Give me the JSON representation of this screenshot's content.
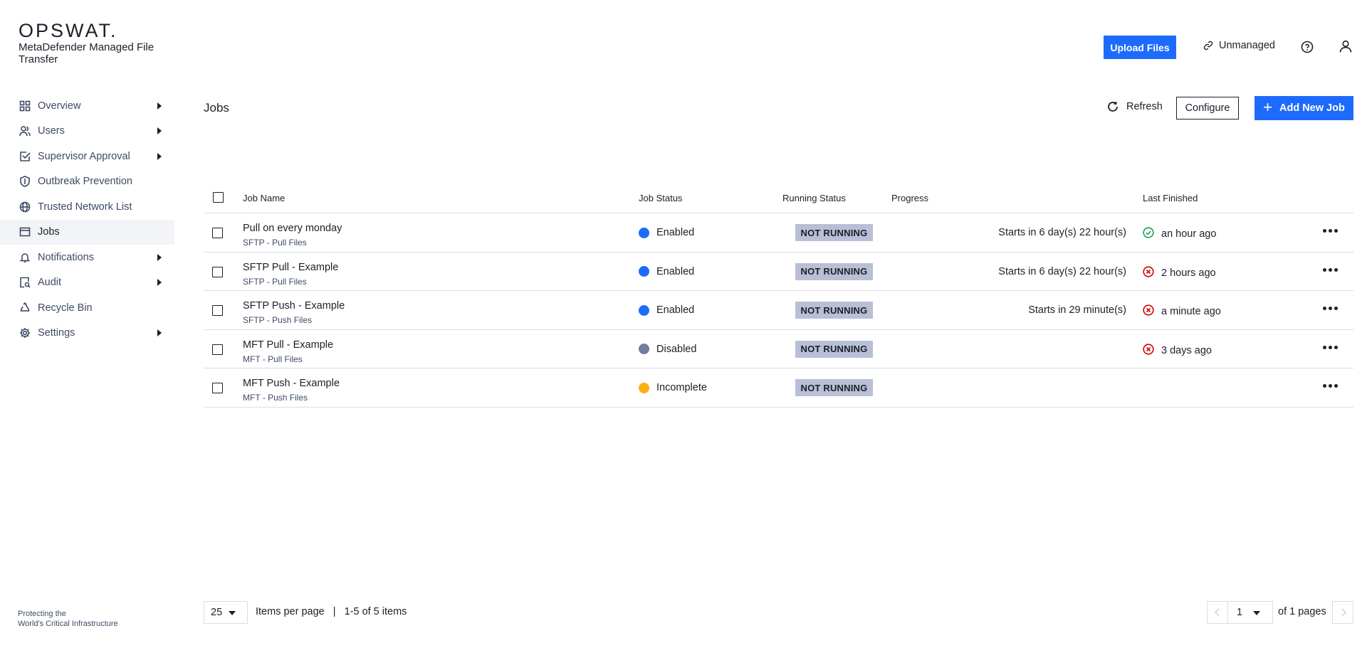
{
  "brand": {
    "logo": "OPSWAT.",
    "product": "MetaDefender Managed File Transfer",
    "tagline_line1": "Protecting the",
    "tagline_line2": "World's Critical Infrastructure"
  },
  "header": {
    "upload_label": "Upload Files",
    "unmanaged_label": "Unmanaged",
    "help_icon": "help-circle-icon",
    "user_icon": "user-icon"
  },
  "sidebar": {
    "items": [
      {
        "label": "Overview",
        "icon": "grid-icon",
        "expandable": true
      },
      {
        "label": "Users",
        "icon": "users-icon",
        "expandable": true
      },
      {
        "label": "Supervisor Approval",
        "icon": "checkbox-icon",
        "expandable": true
      },
      {
        "label": "Outbreak Prevention",
        "icon": "shield-icon",
        "expandable": false
      },
      {
        "label": "Trusted Network List",
        "icon": "globe-icon",
        "expandable": false
      },
      {
        "label": "Jobs",
        "icon": "window-icon",
        "expandable": false,
        "active": true
      },
      {
        "label": "Notifications",
        "icon": "bell-icon",
        "expandable": true
      },
      {
        "label": "Audit",
        "icon": "audit-icon",
        "expandable": true
      },
      {
        "label": "Recycle Bin",
        "icon": "recycle-icon",
        "expandable": false
      },
      {
        "label": "Settings",
        "icon": "gear-icon",
        "expandable": true
      }
    ]
  },
  "page": {
    "title": "Jobs",
    "refresh_label": "Refresh",
    "configure_label": "Configure",
    "add_label": "Add New Job"
  },
  "table": {
    "columns": {
      "name": "Job Name",
      "status": "Job Status",
      "running": "Running Status",
      "progress": "Progress",
      "finished": "Last Finished"
    },
    "rows": [
      {
        "name": "Pull on every monday",
        "type": "SFTP - Pull Files",
        "status": "Enabled",
        "status_color": "#1d6bfc",
        "running": "NOT RUNNING",
        "progress": "Starts in 6 day(s) 22 hour(s)",
        "finished": "an hour ago",
        "finished_state": "success"
      },
      {
        "name": "SFTP Pull - Example",
        "type": "SFTP - Pull Files",
        "status": "Enabled",
        "status_color": "#1d6bfc",
        "running": "NOT RUNNING",
        "progress": "Starts in 6 day(s) 22 hour(s)",
        "finished": "2 hours ago",
        "finished_state": "error"
      },
      {
        "name": "SFTP Push - Example",
        "type": "SFTP - Push Files",
        "status": "Enabled",
        "status_color": "#1d6bfc",
        "running": "NOT RUNNING",
        "progress": "Starts in 29 minute(s)",
        "finished": "a minute ago",
        "finished_state": "error"
      },
      {
        "name": "MFT Pull - Example",
        "type": "MFT - Pull Files",
        "status": "Disabled",
        "status_color": "#707ea0",
        "running": "NOT RUNNING",
        "progress": "",
        "finished": "3 days ago",
        "finished_state": "error"
      },
      {
        "name": "MFT Push - Example",
        "type": "MFT - Push Files",
        "status": "Incomplete",
        "status_color": "#fdb00d",
        "running": "NOT RUNNING",
        "progress": "",
        "finished": "",
        "finished_state": "none"
      }
    ]
  },
  "pagination": {
    "per_page": "25",
    "per_page_label": "Items per page",
    "separator": "|",
    "range": "1-5 of 5 items",
    "current_page": "1",
    "total_pages": "of 1 pages"
  },
  "colors": {
    "accent": "#1d6bfc",
    "success": "#15a350",
    "error": "#d00300",
    "badge": "#b8bfd6"
  }
}
